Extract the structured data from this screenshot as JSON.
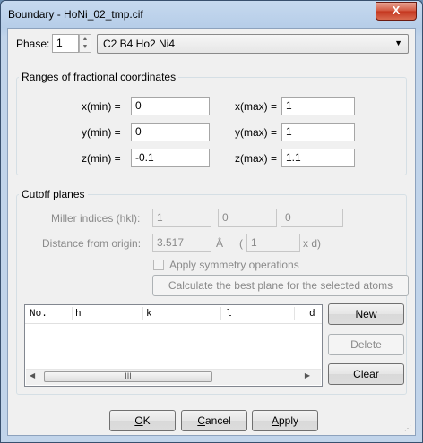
{
  "window": {
    "title": "Boundary - HoNi_02_tmp.cif",
    "close_label": "X"
  },
  "phase": {
    "label": "Phase:",
    "number": "1",
    "formula": "C2 B4 Ho2 Ni4"
  },
  "ranges": {
    "title": "Ranges of fractional coordinates",
    "xmin_label": "x(min) =",
    "xmin": "0",
    "xmax_label": "x(max) =",
    "xmax": "1",
    "ymin_label": "y(min) =",
    "ymin": "0",
    "ymax_label": "y(max) =",
    "ymax": "1",
    "zmin_label": "z(min) =",
    "zmin": "-0.1",
    "zmax_label": "z(max) =",
    "zmax": "1.1"
  },
  "cutoff": {
    "title": "Cutoff planes",
    "miller_label": "Miller indices (hkl):",
    "h": "1",
    "k": "0",
    "l": "0",
    "distance_label": "Distance from origin:",
    "distance": "3.517",
    "angstrom": "Å",
    "paren_open": "(",
    "multiplier": "1",
    "xd": "x d)",
    "symmetry_label": "Apply symmetry operations",
    "calc_label": "Calculate the best plane for the selected atoms"
  },
  "table": {
    "columns": [
      "No.",
      "h",
      "k",
      "l",
      "d"
    ],
    "scroll_thumb": "III"
  },
  "side_buttons": {
    "new": "New",
    "delete": "Delete",
    "clear": "Clear"
  },
  "footer": {
    "ok": "OK",
    "cancel": "Cancel",
    "apply": "Apply"
  }
}
